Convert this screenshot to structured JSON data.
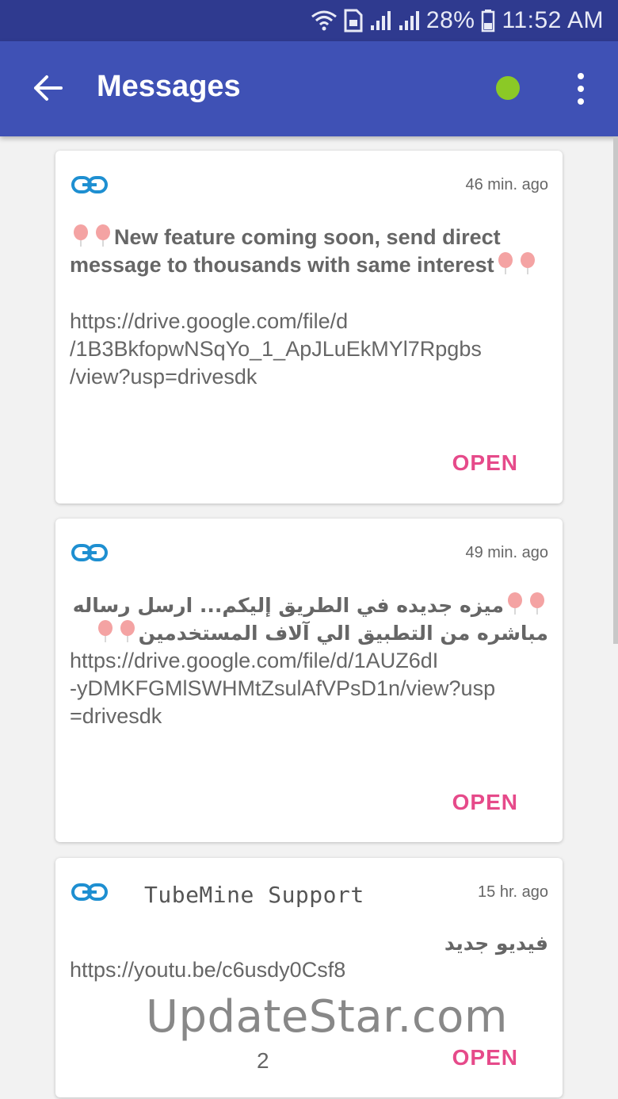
{
  "status_bar": {
    "battery": "28%",
    "time": "11:52 AM"
  },
  "app_bar": {
    "title": "Messages"
  },
  "messages": [
    {
      "time": "46 min. ago",
      "title": "New feature coming soon, send direct message to thousands with same interest",
      "link_lines": [
        "https://drive.google.com/file/d",
        "/1B3BkfopwNSqYo_1_ApJLuEkMYl7Rpgbs",
        "/view?usp=drivesdk"
      ],
      "open_label": "OPEN"
    },
    {
      "time": "49 min. ago",
      "title_line1": "ميزه جديده في الطريق إليكم... ارسل رساله",
      "title_line2": "مباشره من التطبيق الي آلاف المستخدمين",
      "link_lines": [
        "https://drive.google.com/file/d/1AUZ6dI",
        "-yDMKFGMlSWHMtZsulAfVPsD1n/view?usp",
        "=drivesdk"
      ],
      "open_label": "OPEN"
    },
    {
      "time": "15 hr. ago",
      "sender": "TubeMine Support",
      "title": "فيديو جديد",
      "link_lines": [
        "https://youtu.be/c6usdy0Csf8"
      ],
      "open_label": "OPEN"
    }
  ],
  "overlay": {
    "watermark": "UpdateStar.com",
    "page_number": "2"
  },
  "colors": {
    "status_bar": "#2f3a8f",
    "app_bar": "#3f51b5",
    "accent_open": "#e64a8a",
    "link_icon": "#1e8fd1",
    "online_dot": "#8bc926"
  },
  "icons": [
    "wifi-icon",
    "sim-icon",
    "signal-icon",
    "battery-icon",
    "back-arrow-icon",
    "online-status-icon",
    "overflow-menu-icon",
    "link-icon",
    "balloon-icon"
  ]
}
